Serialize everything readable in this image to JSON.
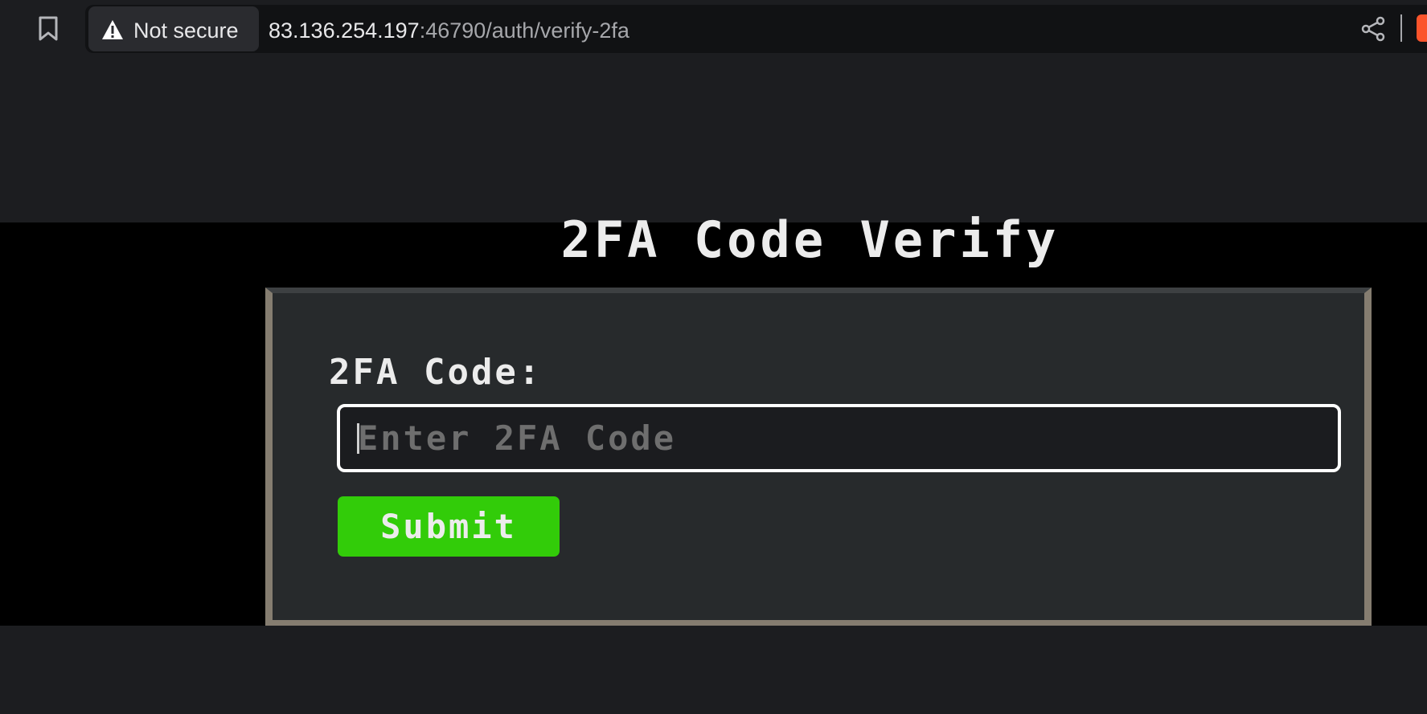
{
  "browser": {
    "security_label": "Not secure",
    "url_host": "83.136.254.197",
    "url_rest": ":46790/auth/verify-2fa",
    "icons": {
      "bookmark": "bookmark-icon",
      "warning": "warning-icon",
      "share": "share-icon",
      "brave": "brave-lion-icon"
    }
  },
  "page": {
    "title": "2FA Code Verify",
    "form": {
      "label": "2FA Code:",
      "input_placeholder": "Enter 2FA Code",
      "input_value": "",
      "submit_label": "Submit"
    }
  },
  "colors": {
    "background": "#000000",
    "panel": "#272a2c",
    "panel_border": "#857d70",
    "submit": "#32cc09",
    "text": "#ececec"
  }
}
